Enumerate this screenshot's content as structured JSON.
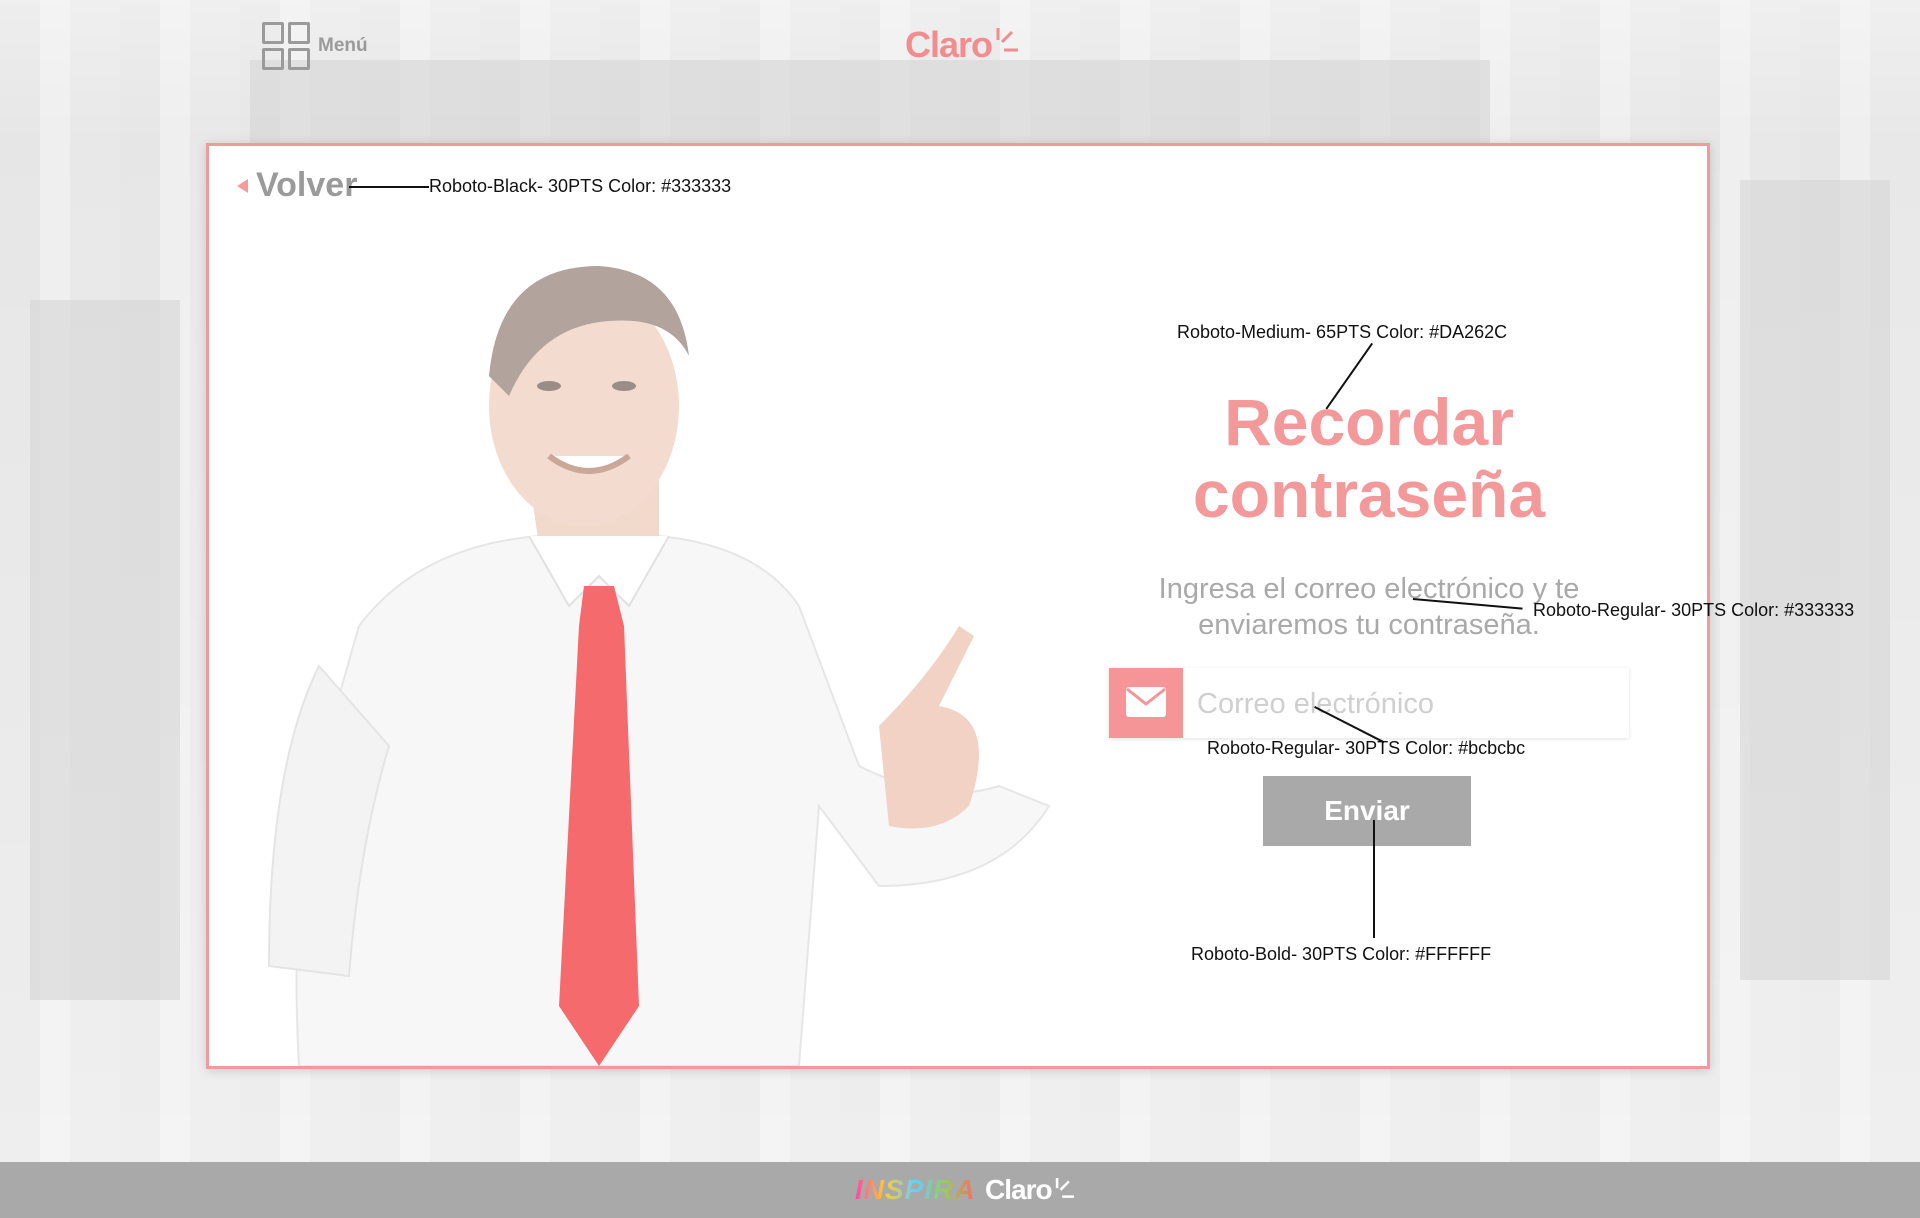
{
  "header": {
    "menu_label": "Menú",
    "logo_text": "Claro"
  },
  "card": {
    "back_label": "Volver",
    "title_line1": "Recordar",
    "title_line2": "contraseña",
    "subtitle_line1": "Ingresa el correo electrónico y te",
    "subtitle_line2": "enviaremos tu contraseña.",
    "email_placeholder": "Correo electrónico",
    "send_label": "Enviar"
  },
  "annotations": {
    "back": "Roboto-Black- 30PTS Color: #333333",
    "title": "Roboto-Medium- 65PTS Color: #DA262C",
    "subtitle": "Roboto-Regular- 30PTS Color: #333333",
    "input": "Roboto-Regular- 30PTS Color: #bcbcbc",
    "button": "Roboto-Bold- 30PTS Color: #FFFFFF"
  },
  "footer": {
    "brand_inspira": "INSPIRA",
    "logo_text": "Claro"
  },
  "colors": {
    "accent": "#f4999a",
    "border": "#f29a9b",
    "button_bg": "#a9a9a9",
    "footer_bg": "#a9a9a9"
  },
  "icons": [
    "grid-menu-icon",
    "back-arrow-icon",
    "mail-icon",
    "claro-logo"
  ]
}
